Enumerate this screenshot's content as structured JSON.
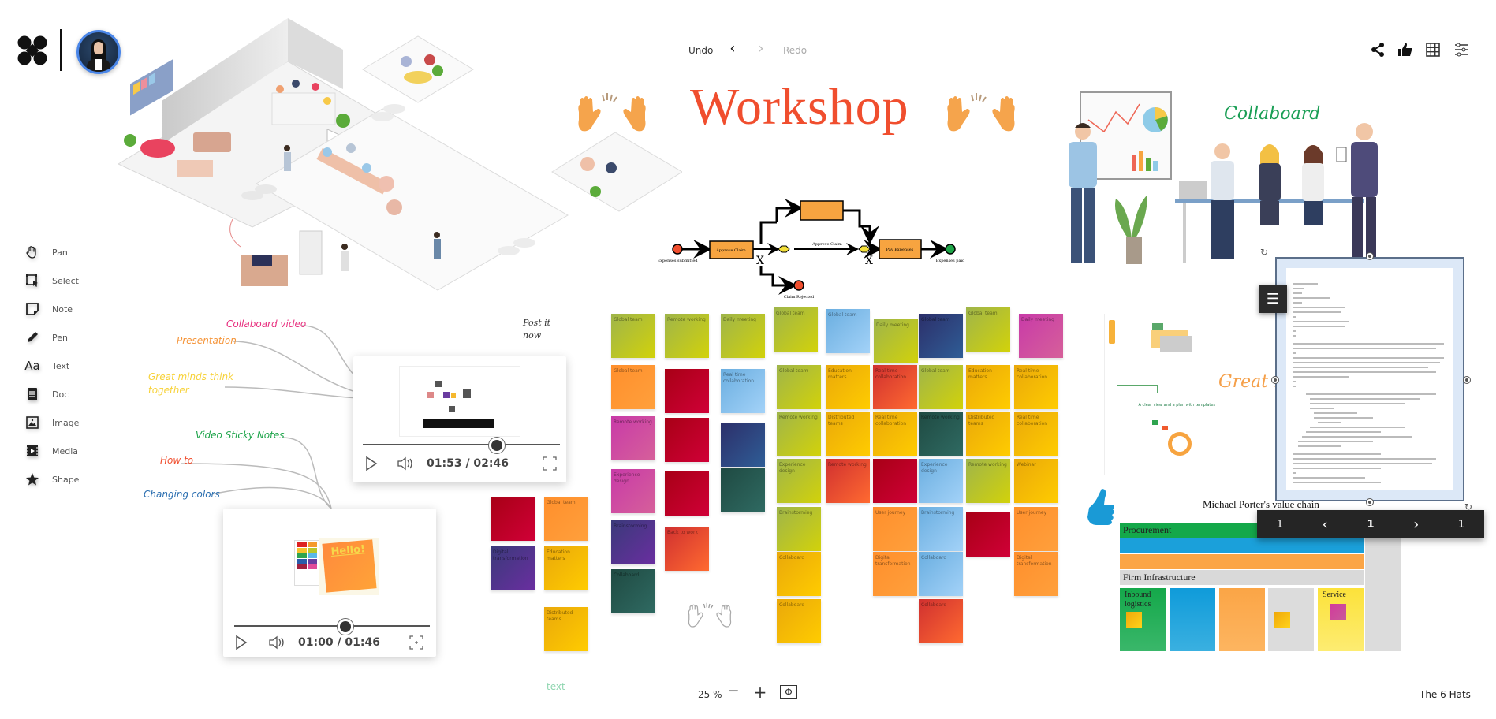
{
  "app": {
    "board_name": "The 6 Hats"
  },
  "header": {
    "undo_label": "Undo",
    "redo_label": "Redo",
    "undo_icon": "chevron-left",
    "redo_icon": "chevron-right",
    "right_icons": [
      "share-icon",
      "thumbs-up-icon",
      "grid-icon",
      "settings-sliders-icon"
    ]
  },
  "toolbar": {
    "items": [
      {
        "label": "Pan",
        "icon": "hand-icon"
      },
      {
        "label": "Select",
        "icon": "select-icon"
      },
      {
        "label": "Note",
        "icon": "note-icon"
      },
      {
        "label": "Pen",
        "icon": "pen-icon"
      },
      {
        "label": "Text",
        "icon": "text-icon",
        "glyph": "Aa"
      },
      {
        "label": "Doc",
        "icon": "doc-icon"
      },
      {
        "label": "Image",
        "icon": "image-icon"
      },
      {
        "label": "Media",
        "icon": "media-icon"
      },
      {
        "label": "Shape",
        "icon": "star-icon"
      }
    ]
  },
  "canvas": {
    "title": "Workshop",
    "collaboard_text": "Collaboard",
    "post_it_text": [
      "Post it",
      "now"
    ],
    "great_minds_text": "Great mi",
    "free_text": "text",
    "mind_map": [
      {
        "label": "Collaboard video",
        "color": "#e8307f"
      },
      {
        "label": "Presentation",
        "color": "#f5963c"
      },
      {
        "label": "Great minds think",
        "label2": "together",
        "color": "#f7d23a"
      },
      {
        "label": "Video Sticky Notes",
        "color": "#1da44a"
      },
      {
        "label": "How to",
        "color": "#f04e2e"
      },
      {
        "label": "Changing colors",
        "color": "#2a6eb0"
      }
    ],
    "videos": [
      {
        "time": "01:53 / 02:46",
        "progress": 0.68
      },
      {
        "time": "01:00 / 01:46",
        "progress": 0.57,
        "note_text": "Hello!"
      }
    ],
    "process": {
      "start_label": "Expenses submitted",
      "task1": "Approve Claim",
      "task_middle": "Approve Claim",
      "task2": "Pay Expenses",
      "end_label": "Expenses paid",
      "rejected_label": "Claim Rejected",
      "gateway": "X"
    },
    "sticky_notes": {
      "texts": [
        "Global team",
        "Remote working",
        "Daily meeting",
        "Real time collaboration",
        "Education matters",
        "Distributed teams",
        "Experience design",
        "Brainstorming",
        "User journey",
        "Digital transformation",
        "Collaboard",
        "Webinar",
        "Back to work"
      ]
    },
    "value_chain": {
      "title": "Michael Porter's value chain",
      "bands": [
        "Procurement",
        "",
        "",
        "Firm Infrastructure"
      ],
      "columns": [
        "Inbound logistics",
        "",
        "",
        "",
        "Service"
      ]
    },
    "doc_viewer": {
      "menu_icon": "hamburger-icon",
      "pager": {
        "first": "1",
        "prev_icon": "chevron-left",
        "current": "1",
        "next_icon": "chevron-right",
        "last": "1"
      }
    }
  },
  "footer": {
    "zoom_level": "25 %",
    "zoom_out": "−",
    "zoom_in": "+",
    "fit_icon": "Φ"
  },
  "colors": {
    "title_red": "#f04e2e",
    "avatar_ring": "#4a86e8",
    "collab_green": "#1a9e55"
  }
}
